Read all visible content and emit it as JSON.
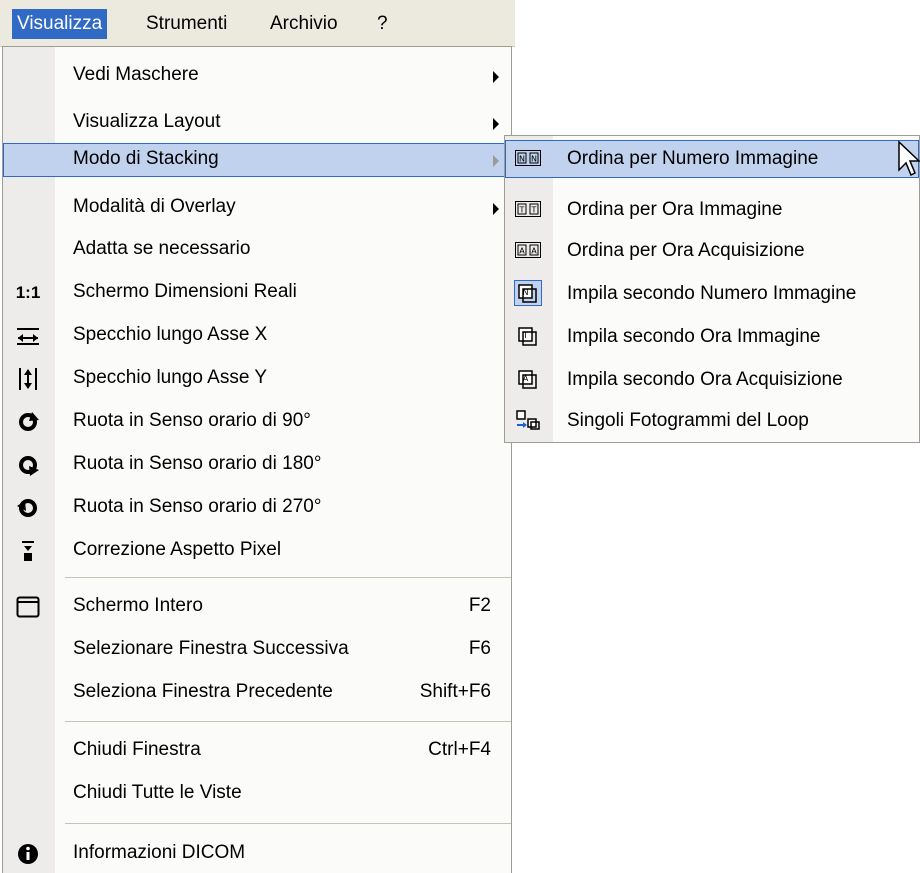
{
  "menubar": {
    "items": [
      {
        "label": "Visualizza",
        "active": true
      },
      {
        "label": "Strumenti",
        "active": false
      },
      {
        "label": "Archivio",
        "active": false
      },
      {
        "label": "?",
        "active": false
      }
    ]
  },
  "menu": {
    "items": [
      {
        "label": "Vedi Maschere",
        "submenu": true
      },
      {
        "label": "Visualizza Layout",
        "submenu": true
      },
      {
        "label": "Modo di Stacking",
        "submenu": true,
        "highlighted": true
      },
      {
        "label": "Modalità di Overlay",
        "submenu": true
      },
      {
        "label": "Adatta se necessario"
      },
      {
        "label": "Schermo Dimensioni Reali",
        "icon": "1:1"
      },
      {
        "label": "Specchio lungo Asse X",
        "icon": "mirror-x-icon"
      },
      {
        "label": "Specchio lungo Asse Y",
        "icon": "mirror-y-icon"
      },
      {
        "label": "Ruota in Senso orario di 90°",
        "icon": "rotate-90-icon"
      },
      {
        "label": "Ruota in Senso orario di 180°",
        "icon": "rotate-180-icon"
      },
      {
        "label": "Ruota in Senso orario di 270°",
        "icon": "rotate-270-icon"
      },
      {
        "label": "Correzione Aspetto Pixel",
        "icon": "pixel-aspect-icon"
      },
      {
        "label": "Schermo Intero",
        "shortcut": "F2",
        "icon": "fullscreen-icon"
      },
      {
        "label": "Selezionare Finestra Successiva",
        "shortcut": "F6"
      },
      {
        "label": "Seleziona Finestra Precedente",
        "shortcut": "Shift+F6"
      },
      {
        "label": "Chiudi Finestra",
        "shortcut": "Ctrl+F4"
      },
      {
        "label": "Chiudi Tutte le Viste"
      },
      {
        "label": "Informazioni DICOM",
        "icon": "info-icon"
      }
    ]
  },
  "submenu": {
    "items": [
      {
        "label": "Ordina per Numero Immagine",
        "icon_text": "NN",
        "highlighted": true
      },
      {
        "label": "Ordina per Ora Immagine",
        "icon_text": "TT"
      },
      {
        "label": "Ordina per Ora Acquisizione",
        "icon_text": "AA"
      },
      {
        "label": "Impila secondo Numero Immagine",
        "icon_text": "N",
        "checked": true
      },
      {
        "label": "Impila secondo Ora Immagine",
        "icon_text": "T"
      },
      {
        "label": "Impila secondo Ora Acquisizione",
        "icon_text": "A"
      },
      {
        "label": "Singoli Fotogrammi del Loop",
        "icon_text": ""
      }
    ]
  },
  "colors": {
    "highlight_bg": "#c1d2ee",
    "highlight_border": "#316ac5",
    "menubar_active": "#316ac5",
    "gutter": "#edecea"
  }
}
